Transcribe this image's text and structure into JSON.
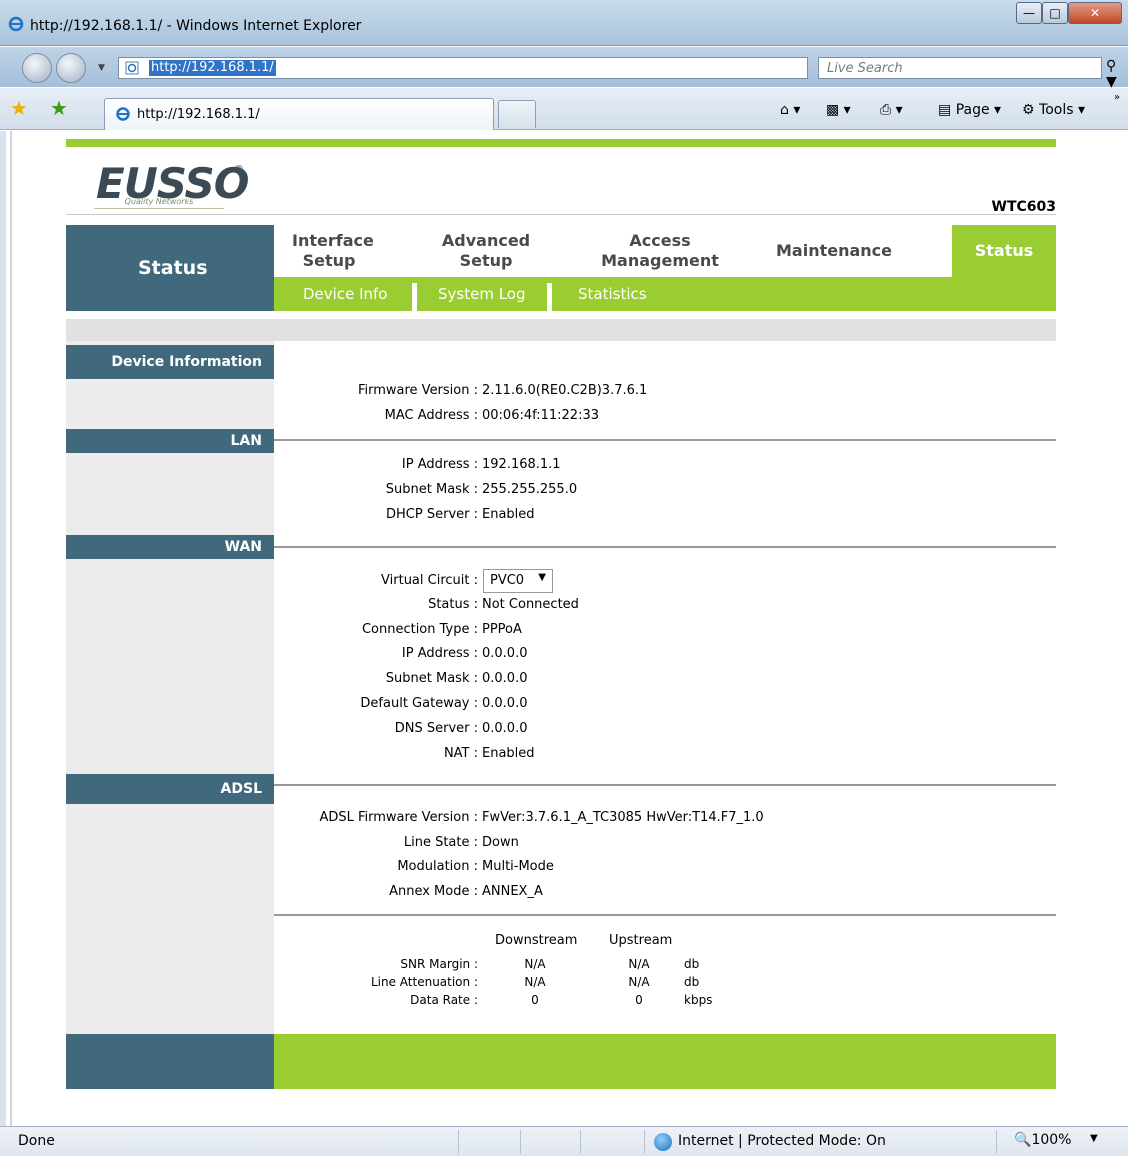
{
  "window": {
    "title": "http://192.168.1.1/ - Windows Internet Explorer",
    "address": "http://192.168.1.1/",
    "search_placeholder": "Live Search",
    "tab_label": "http://192.168.1.1/",
    "tools": {
      "page": "Page",
      "tools": "Tools"
    }
  },
  "header": {
    "logo": "EUSSO",
    "logo_reg": "®",
    "tagline": "Quality Networks",
    "model": "WTC603"
  },
  "nav": {
    "current_section": "Status",
    "menu": [
      {
        "line1": "Interface",
        "line2": "Setup"
      },
      {
        "line1": "Advanced",
        "line2": "Setup"
      },
      {
        "line1": "Access",
        "line2": "Management"
      },
      {
        "line1": "Maintenance",
        "line2": ""
      }
    ],
    "active_menu": "Status",
    "submenu": [
      "Device Info",
      "System Log",
      "Statistics"
    ]
  },
  "sections": {
    "device": "Device Information",
    "lan": "LAN",
    "wan": "WAN",
    "adsl": "ADSL"
  },
  "device": {
    "firmware_label": "Firmware Version :",
    "firmware": "2.11.6.0(RE0.C2B)3.7.6.1",
    "mac_label": "MAC Address :",
    "mac": "00:06:4f:11:22:33"
  },
  "lan": {
    "ip_label": "IP Address :",
    "ip": "192.168.1.1",
    "mask_label": "Subnet Mask :",
    "mask": "255.255.255.0",
    "dhcp_label": "DHCP Server :",
    "dhcp": "Enabled"
  },
  "wan": {
    "vc_label": "Virtual Circuit :",
    "vc_selected": "PVC0",
    "status_label": "Status :",
    "status": "Not Connected",
    "conn_label": "Connection Type :",
    "conn": "PPPoA",
    "ip_label": "IP Address :",
    "ip": "0.0.0.0",
    "mask_label": "Subnet Mask :",
    "mask": "0.0.0.0",
    "gw_label": "Default Gateway :",
    "gw": "0.0.0.0",
    "dns_label": "DNS Server :",
    "dns": "0.0.0.0",
    "nat_label": "NAT :",
    "nat": "Enabled"
  },
  "adsl": {
    "fw_label": "ADSL Firmware Version :",
    "fw": "FwVer:3.7.6.1_A_TC3085 HwVer:T14.F7_1.0",
    "line_label": "Line State :",
    "line": "Down",
    "mod_label": "Modulation :",
    "mod": "Multi-Mode",
    "annex_label": "Annex Mode :",
    "annex": "ANNEX_A",
    "stats": {
      "col_down": "Downstream",
      "col_up": "Upstream",
      "rows": [
        {
          "label": "SNR Margin :",
          "down": "N/A",
          "up": "N/A",
          "unit": "db"
        },
        {
          "label": "Line Attenuation :",
          "down": "N/A",
          "up": "N/A",
          "unit": "db"
        },
        {
          "label": "Data Rate :",
          "down": "0",
          "up": "0",
          "unit": "kbps"
        }
      ]
    }
  },
  "statusbar": {
    "left": "Done",
    "zone": "Internet | Protected Mode: On",
    "zoom": "100%"
  }
}
